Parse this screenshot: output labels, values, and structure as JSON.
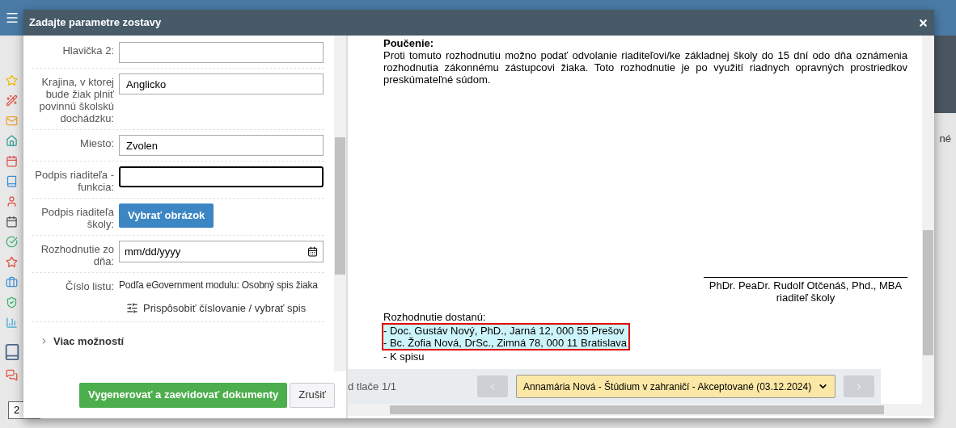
{
  "background": {
    "texts": [
      "né",
      "2"
    ]
  },
  "dialog": {
    "title": "Zadajte parametre zostavy"
  },
  "form": {
    "fields": [
      {
        "kind": "text",
        "label": "Hlavička 2:",
        "focused": false
      },
      {
        "kind": "text",
        "label": "Krajina, v ktorej bude žiak plniť povinnú školskú dochádzku:",
        "value": "Anglicko",
        "focused": false
      },
      {
        "kind": "text",
        "label": "Miesto:",
        "value": "Zvolen",
        "focused": false
      },
      {
        "kind": "text",
        "label": "Podpis riaditeľa - funkcia:",
        "focused": true
      },
      {
        "kind": "button",
        "label": "Podpis riaditeľa školy:",
        "button": "Vybrať obrázok"
      },
      {
        "kind": "date",
        "label": "Rozhodnutie zo dňa:",
        "placeholder": "mm/dd/yyyy"
      },
      {
        "kind": "info",
        "label": "Číslo listu:",
        "value": "Podľa eGovernment modulu: Osobný spis žiaka",
        "link": "Prispôsobiť číslovanie / vybrať spis"
      }
    ],
    "more_options": {
      "label": "Viac možností",
      "expanded": false
    }
  },
  "buttons": [
    {
      "kind": "primary",
      "label": "Vygenerovať a zaevidovať dokumenty"
    },
    {
      "kind": "default",
      "label": "Zrušiť"
    }
  ],
  "preview": {
    "heading": "Poučenie:",
    "paragraph": "Proti tomuto rozhodnutiu možno podať odvolanie riaditeľovi/ke základnej školy do 15 dní odo dňa oznámenia rozhodnutia zákonnému zástupcovi žiaka. Toto rozhodnutie je po využití riadnych opravných prostriedkov preskúmateľné súdom.",
    "signature_name": "PhDr. PeaDr. Rudolf Otčenáš, Phd., MBA",
    "signature_role": "riaditeľ školy",
    "recipients_heading": "Rozhodnutie dostanú:",
    "recipients": [
      {
        "text": "- Doc. Gustáv Nový, PhD., Jarná 12, 000 55 Prešov",
        "highlighted": true
      },
      {
        "text": "- Bc. Žofia Nová, DrSc., Zimná 78, 000 11 Bratislava",
        "highlighted": true
      },
      {
        "text": "- K spisu",
        "highlighted": false
      }
    ]
  },
  "pager": {
    "page_label": "d tlače 1/1",
    "selected_document": "Annamária Nová - Štúdium v zahraničí - Akceptované (03.12.2024)"
  }
}
